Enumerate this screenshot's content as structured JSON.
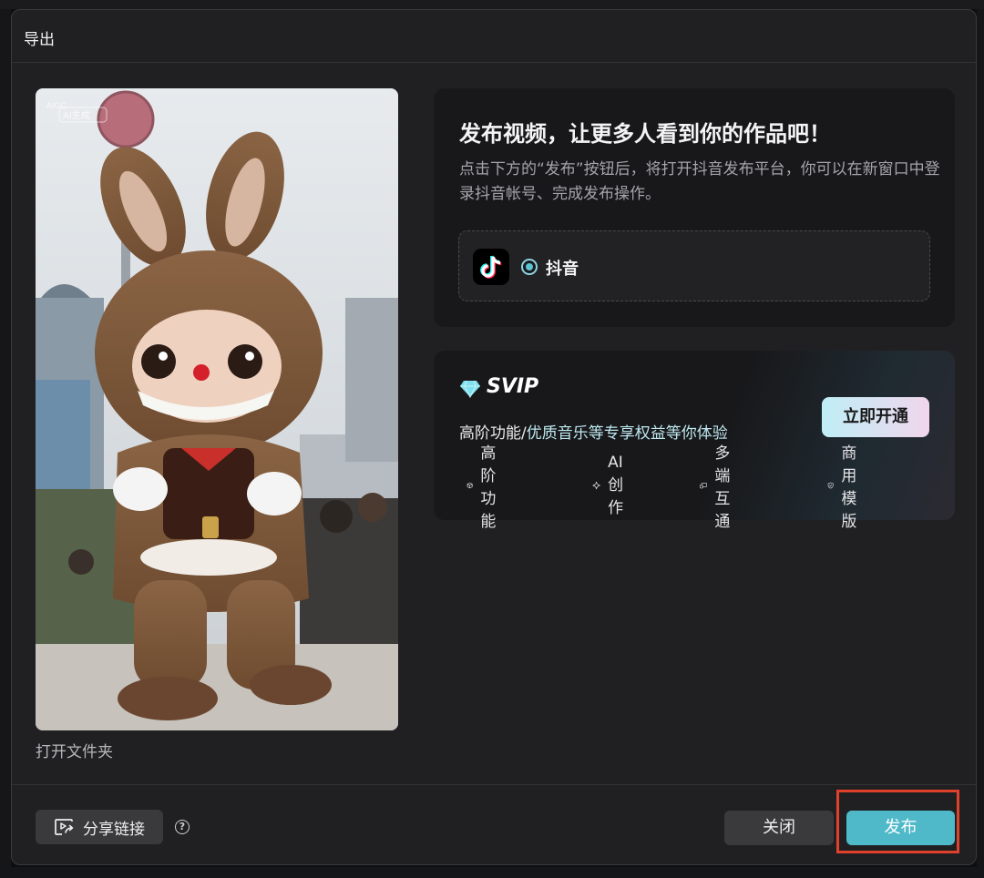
{
  "dialog": {
    "title": "导出"
  },
  "preview": {
    "watermark_line1": "AIGC",
    "watermark_line2": "AI生成",
    "open_folder_label": "打开文件夹"
  },
  "publish": {
    "heading": "发布视频，让更多人看到你的作品吧！",
    "description": "点击下方的“发布”按钮后，将打开抖音发布平台，你可以在新窗口中登录抖音帐号、完成发布操作。",
    "platform": {
      "name": "抖音",
      "selected": true,
      "icon": "douyin-logo-icon"
    }
  },
  "svip": {
    "title": "SVIP",
    "desc_part1": "高阶功能/",
    "desc_part2": "优质音乐等专享权益等你体验",
    "cta_label": "立即开通",
    "features": [
      {
        "label": "高阶功能",
        "icon": "cube-icon"
      },
      {
        "label": "AI创作",
        "icon": "sparkle-icon"
      },
      {
        "label": "多端互通",
        "icon": "devices-icon"
      },
      {
        "label": "商用模版",
        "icon": "shield-check-icon"
      }
    ]
  },
  "footer": {
    "share_label": "分享链接",
    "help_glyph": "?",
    "close_label": "关闭",
    "publish_label": "发布"
  },
  "colors": {
    "accent": "#4fb9c9",
    "highlight": "#e0412b",
    "panel": "#18181a",
    "dialog": "#202022"
  }
}
